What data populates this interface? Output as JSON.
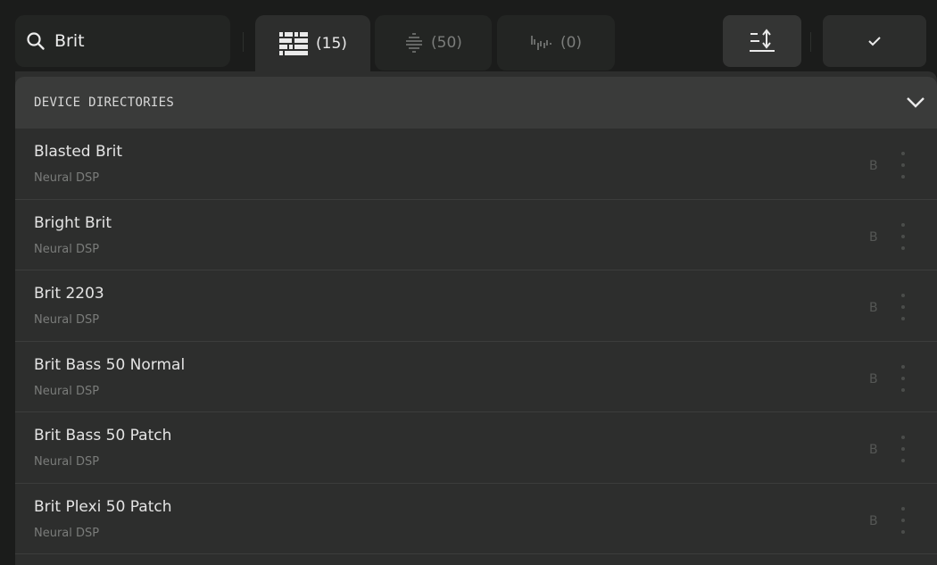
{
  "search": {
    "value": "Brit"
  },
  "tabs": [
    {
      "icon": "grid-blocks-icon",
      "count": "(15)",
      "active": true
    },
    {
      "icon": "stacked-lines-icon",
      "count": "(50)",
      "active": false
    },
    {
      "icon": "waveform-bars-icon",
      "count": "(0)",
      "active": false
    }
  ],
  "toolbar": {
    "sort_icon": "sort-lines-icon",
    "confirm_icon": "checkmark-icon"
  },
  "section": {
    "title": "DEVICE DIRECTORIES",
    "chevron_icon": "chevron-down-icon"
  },
  "items": [
    {
      "name": "Blasted Brit",
      "maker": "Neural DSP",
      "badge": "B"
    },
    {
      "name": "Bright Brit",
      "maker": "Neural DSP",
      "badge": "B"
    },
    {
      "name": "Brit 2203",
      "maker": "Neural DSP",
      "badge": "B"
    },
    {
      "name": "Brit Bass 50 Normal",
      "maker": "Neural DSP",
      "badge": "B"
    },
    {
      "name": "Brit Bass 50 Patch",
      "maker": "Neural DSP",
      "badge": "B"
    },
    {
      "name": "Brit Plexi 50 Patch",
      "maker": "Neural DSP",
      "badge": "B"
    }
  ],
  "colors": {
    "background": "#1b1c1b",
    "panel": "#2d2e2d",
    "section_header": "#3a3b3a",
    "text": "#e4e4e4",
    "muted": "#7a7c7a"
  }
}
